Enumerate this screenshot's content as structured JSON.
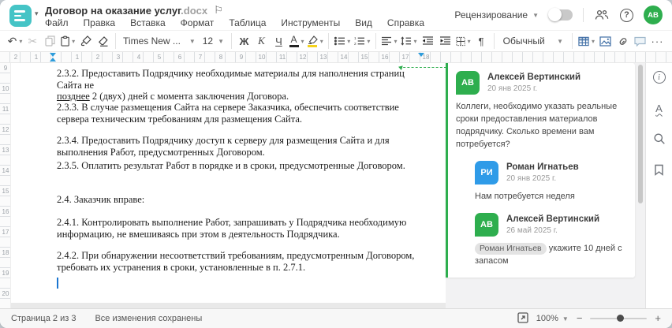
{
  "window": {
    "title": "Договор на оказание услуг",
    "ext": ".docx"
  },
  "menu": {
    "items": [
      "Файл",
      "Правка",
      "Вставка",
      "Формат",
      "Таблица",
      "Инструменты",
      "Вид",
      "Справка"
    ]
  },
  "header_right": {
    "review_label": "Рецензирование",
    "avatar_initials": "АВ"
  },
  "toolbar": {
    "font_name": "Times New ...",
    "font_size": "12",
    "bold": "Ж",
    "italic": "К",
    "underline": "Ч",
    "font_color_letter": "А",
    "style_name": "Обычный",
    "pilcrow": "¶",
    "more": "···"
  },
  "ruler": {
    "h_labels": [
      "2",
      "1",
      "",
      "1",
      "2",
      "3",
      "4",
      "5",
      "6",
      "7",
      "8",
      "9",
      "10",
      "11",
      "12",
      "13",
      "14",
      "15",
      "16",
      "17",
      "18"
    ],
    "v_labels": [
      "9",
      "10",
      "11",
      "12",
      "13",
      "14",
      "15",
      "16",
      "17",
      "18",
      "19",
      "20"
    ]
  },
  "document": {
    "p232_line1": "2.3.2. Предоставить Подрядчику необходимые материалы для наполнения страниц Сайта не",
    "p232_underlined": "позднее",
    "p232_rest": " 2 (двух) дней с момента заключения Договора.",
    "p233": "2.3.3. В случае размещения Сайта на сервере Заказчика, обеспечить соответствие сервера техническим требованиям для размещения Сайта.",
    "p234": "2.3.4. Предоставить Подрядчику доступ к серверу для размещения Сайта и для выполнения Работ, предусмотренных Договором.",
    "p235": "2.3.5. Оплатить результат Работ в порядке и в сроки, предусмотренные Договором.",
    "p24": "2.4. Заказчик вправе:",
    "p241": "2.4.1. Контролировать выполнение Работ, запрашивать у Подрядчика необходимую информацию, не вмешиваясь при этом в деятельность Подрядчика.",
    "p242": "2.4.2. При обнаружении несоответствий требованиям, предусмотренным Договором, требовать их устранения в сроки, установленные в п. 2.7.1."
  },
  "comments": {
    "c1": {
      "initials": "АВ",
      "author": "Алексей Вертинский",
      "date": "20 янв 2025 г.",
      "text": "Коллеги, необходимо указать реальные сроки предоставления материалов подрядчику. Сколько времени вам потребуется?"
    },
    "r1": {
      "initials": "РИ",
      "author": "Роман Игнатьев",
      "date": "20 янв 2025 г.",
      "text": "Нам потребуется неделя"
    },
    "r2": {
      "initials": "АВ",
      "author": "Алексей Вертинский",
      "date": "26 май 2025 г.",
      "mention": "Роман Игнатьев",
      "text": " укажите 10 дней с запасом"
    }
  },
  "statusbar": {
    "page": "Страница 2 из 3",
    "saved": "Все изменения сохранены",
    "zoom": "100%"
  },
  "colors": {
    "accent_teal": "#45c4c6",
    "green": "#2eae4e",
    "blue": "#2f9be8",
    "toolbar_blue": "#3f6ea5",
    "highlight_yellow": "#f4d21a"
  }
}
